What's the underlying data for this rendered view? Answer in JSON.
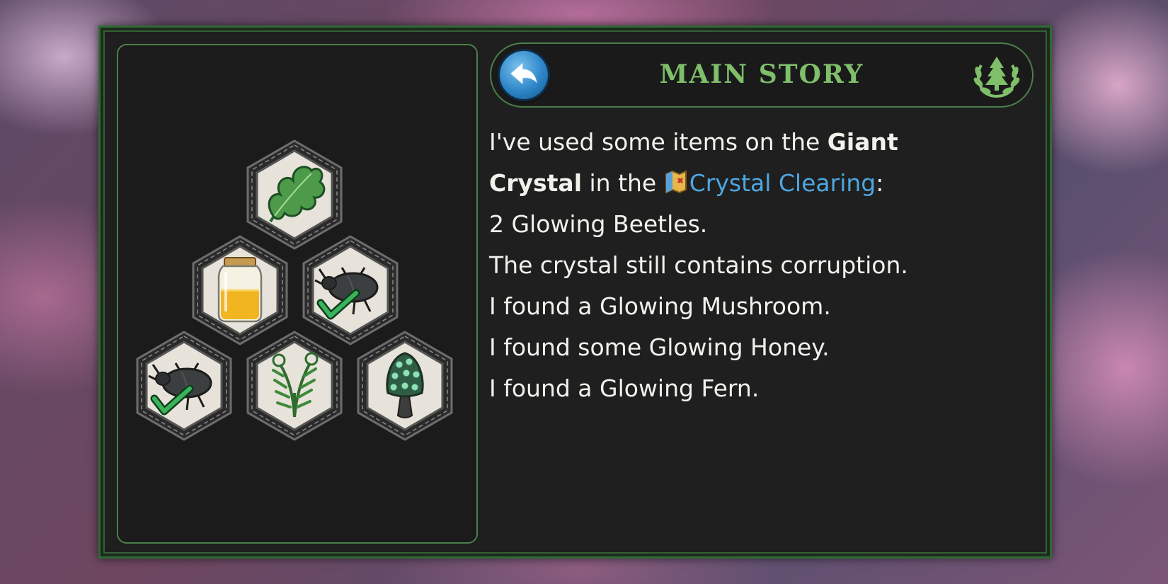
{
  "header": {
    "title": "MAIN STORY",
    "back_icon": "back-arrow-icon",
    "emblem_icon": "tree-laurel-icon"
  },
  "story": {
    "intro_pre": "I've used some items on the ",
    "intro_bold_1": "Giant",
    "intro_bold_2": "Crystal",
    "intro_mid": " in the ",
    "location": "Crystal Clearing",
    "intro_post": ":",
    "lines": [
      "2 Glowing Beetles.",
      "The crystal still contains corruption.",
      "I found a Glowing Mushroom.",
      "I found some Glowing Honey.",
      "I found a Glowing Fern."
    ]
  },
  "items": [
    {
      "name": "oak-leaf-icon",
      "checked": false
    },
    {
      "name": "honey-jar-icon",
      "checked": false
    },
    {
      "name": "beetle-icon",
      "checked": true
    },
    {
      "name": "beetle-icon",
      "checked": true
    },
    {
      "name": "fern-icon",
      "checked": false
    },
    {
      "name": "mushroom-icon",
      "checked": false
    }
  ],
  "colors": {
    "frame_green": "#2f6a33",
    "title_green": "#7fbf6a",
    "location_blue": "#4fa6e0",
    "text": "#f3f1ec"
  }
}
